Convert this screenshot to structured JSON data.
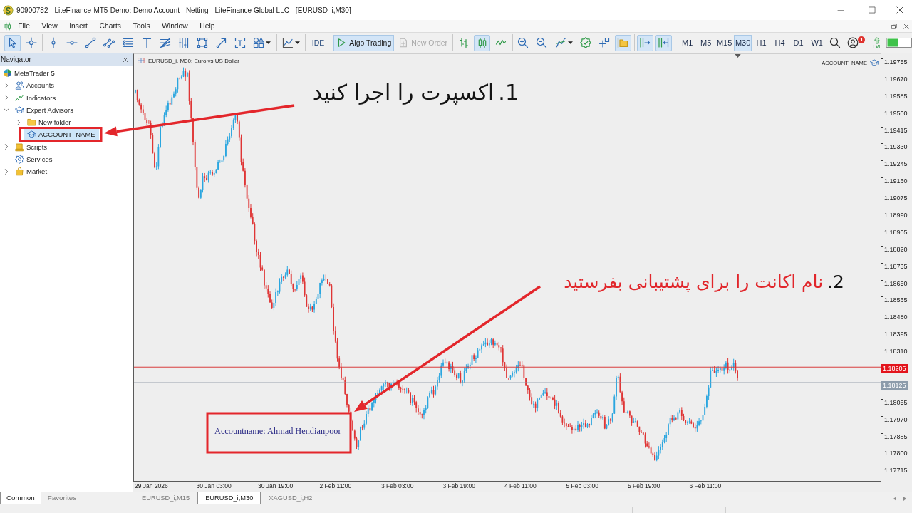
{
  "window": {
    "title": "90900782 - LiteFinance-MT5-Demo: Demo Account - Netting - LiteFinance Global LLC - [EURUSD_i,M30]"
  },
  "menu": [
    "File",
    "View",
    "Insert",
    "Charts",
    "Tools",
    "Window",
    "Help"
  ],
  "toolbar": {
    "tool_groups": [
      [
        {
          "kind": "cursor",
          "selected": true
        },
        {
          "kind": "crosshair",
          "selected": false
        }
      ],
      [
        {
          "kind": "vline",
          "selected": false
        },
        {
          "kind": "hline",
          "selected": false
        },
        {
          "kind": "trend",
          "selected": false
        },
        {
          "kind": "channel",
          "selected": false
        },
        {
          "kind": "levels",
          "selected": false
        },
        {
          "kind": "text",
          "selected": false
        },
        {
          "kind": "fan",
          "selected": false
        },
        {
          "kind": "gann",
          "selected": false
        },
        {
          "kind": "rectangle",
          "selected": false
        },
        {
          "kind": "arrow",
          "selected": false
        },
        {
          "kind": "label",
          "selected": false
        },
        {
          "kind": "shapes",
          "selected": false
        }
      ],
      [
        {
          "kind": "indicator",
          "selected": false
        }
      ]
    ],
    "commands": [
      {
        "kind": "ide",
        "label": "IDE",
        "on": false,
        "disabled": false
      },
      {
        "kind": "algo",
        "label": "Algo Trading",
        "on": true,
        "disabled": false
      },
      {
        "kind": "order",
        "label": "New Order",
        "on": false,
        "disabled": true
      }
    ],
    "chart_groups": [
      [
        {
          "kind": "bars",
          "selected": false
        },
        {
          "kind": "candles",
          "selected": true
        },
        {
          "kind": "line",
          "selected": false
        }
      ],
      [
        {
          "kind": "zoom-in",
          "selected": false
        },
        {
          "kind": "zoom-out",
          "selected": false
        },
        {
          "kind": "indicators",
          "selected": false
        },
        {
          "kind": "properties",
          "selected": false
        },
        {
          "kind": "add",
          "selected": false
        },
        {
          "kind": "templates",
          "selected": true
        }
      ],
      [
        {
          "kind": "autoscroll",
          "selected": true
        },
        {
          "kind": "shift",
          "selected": true
        }
      ]
    ],
    "timeframes": [
      {
        "label": "M1",
        "selected": false
      },
      {
        "label": "M5",
        "selected": false
      },
      {
        "label": "M15",
        "selected": false
      },
      {
        "label": "M30",
        "selected": true
      },
      {
        "label": "H1",
        "selected": false
      },
      {
        "label": "H4",
        "selected": false
      },
      {
        "label": "D1",
        "selected": false
      },
      {
        "label": "W1",
        "selected": false
      }
    ],
    "extras": [
      {
        "kind": "search"
      },
      {
        "kind": "account",
        "badge": "1"
      },
      {
        "kind": "level",
        "label": "LVL"
      },
      {
        "kind": "meter"
      }
    ]
  },
  "navigator": {
    "title": "Navigator",
    "tree": [
      {
        "label": "MetaTrader 5",
        "kind": "root",
        "selected": false,
        "children": [
          {
            "label": "Accounts",
            "kind": "accounts",
            "expanded": false,
            "selected": false
          },
          {
            "label": "Indicators",
            "kind": "indicators",
            "expanded": false,
            "selected": false
          },
          {
            "label": "Expert Advisors",
            "kind": "experts",
            "expanded": true,
            "selected": false,
            "children": [
              {
                "label": "New folder",
                "kind": "folder",
                "expanded": false,
                "selected": false
              },
              {
                "label": "ACCOUNT_NAME",
                "kind": "expert",
                "selected": true
              }
            ]
          },
          {
            "label": "Scripts",
            "kind": "scripts",
            "expanded": false,
            "selected": false
          },
          {
            "label": "Services",
            "kind": "services",
            "selected": false
          },
          {
            "label": "Market",
            "kind": "market",
            "expanded": false,
            "selected": false
          }
        ]
      }
    ],
    "tabs": [
      {
        "label": "Common",
        "selected": true
      },
      {
        "label": "Favorites",
        "selected": false
      }
    ]
  },
  "chart": {
    "title": "EURUSD_i, M30: Euro vs US Dollar",
    "expert_label": "ACCOUNT_NAME",
    "account_text": "Accountname: Ahmad Hendianpoor",
    "price_axis": [
      {
        "kind": "tick",
        "label": "1.19755"
      },
      {
        "kind": "tick",
        "label": "1.19670"
      },
      {
        "kind": "tick",
        "label": "1.19585"
      },
      {
        "kind": "tick",
        "label": "1.19500"
      },
      {
        "kind": "tick",
        "label": "1.19415"
      },
      {
        "kind": "tick",
        "label": "1.19330"
      },
      {
        "kind": "tick",
        "label": "1.19245"
      },
      {
        "kind": "tick",
        "label": "1.19160"
      },
      {
        "kind": "tick",
        "label": "1.19075"
      },
      {
        "kind": "tick",
        "label": "1.18990"
      },
      {
        "kind": "tick",
        "label": "1.18905"
      },
      {
        "kind": "tick",
        "label": "1.18820"
      },
      {
        "kind": "tick",
        "label": "1.18735"
      },
      {
        "kind": "tick",
        "label": "1.18650"
      },
      {
        "kind": "tick",
        "label": "1.18565"
      },
      {
        "kind": "tick",
        "label": "1.18480"
      },
      {
        "kind": "tick",
        "label": "1.18395"
      },
      {
        "kind": "tick",
        "label": "1.18310"
      },
      {
        "kind": "bid",
        "label": "1.18205"
      },
      {
        "kind": "ask",
        "label": "1.18125"
      },
      {
        "kind": "tick",
        "label": "1.18055"
      },
      {
        "kind": "tick",
        "label": "1.17970"
      },
      {
        "kind": "tick",
        "label": "1.17885"
      },
      {
        "kind": "tick",
        "label": "1.17800"
      },
      {
        "kind": "tick",
        "label": "1.17715"
      }
    ],
    "time_axis": [
      "29 Jan 2026",
      "30 Jan 03:00",
      "30 Jan 19:00",
      "2 Feb 11:00",
      "3 Feb 03:00",
      "3 Feb 19:00",
      "4 Feb 11:00",
      "5 Feb 03:00",
      "5 Feb 19:00",
      "6 Feb 11:00"
    ]
  },
  "chart_tabs": [
    {
      "label": "EURUSD_i,M15",
      "selected": false
    },
    {
      "label": "EURUSD_i,M30",
      "selected": true
    },
    {
      "label": "XAGUSD_i,H2",
      "selected": false
    }
  ],
  "annotations": [
    {
      "number": "1.",
      "text": "اکسپرت را اجرا کنید",
      "color": "#141414"
    },
    {
      "number": "2.",
      "text": "نام اکانت را برای پشتیبانی بفرستید",
      "color": "#e1262b"
    }
  ]
}
